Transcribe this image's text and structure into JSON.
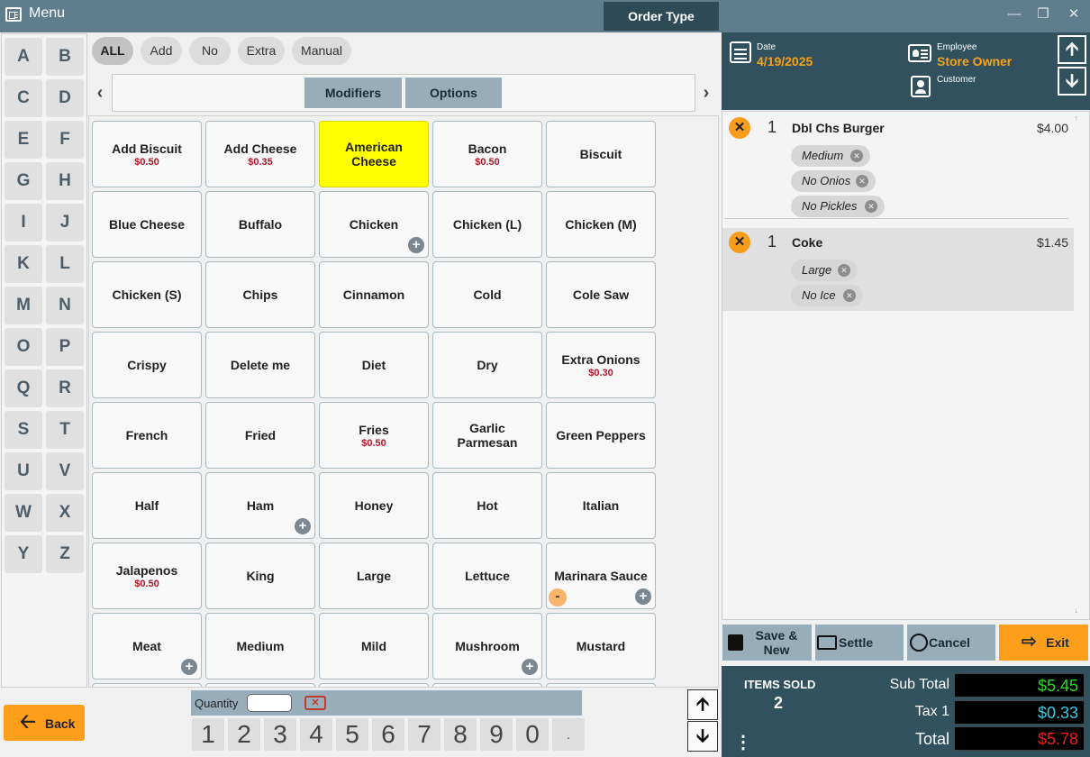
{
  "window": {
    "title": "Menu",
    "order_type": "Order Type"
  },
  "letters": [
    "A",
    "B",
    "C",
    "D",
    "E",
    "F",
    "G",
    "H",
    "I",
    "J",
    "K",
    "L",
    "M",
    "N",
    "O",
    "P",
    "Q",
    "R",
    "S",
    "T",
    "U",
    "V",
    "W",
    "X",
    "Y",
    "Z"
  ],
  "filters": [
    {
      "label": "ALL",
      "active": true
    },
    {
      "label": "Add",
      "active": false
    },
    {
      "label": "No",
      "active": false
    },
    {
      "label": "Extra",
      "active": false
    },
    {
      "label": "Manual",
      "active": false
    }
  ],
  "tabs": [
    {
      "label": "Modifiers"
    },
    {
      "label": "Options"
    }
  ],
  "items": [
    {
      "name": "Add Biscuit",
      "price": "$0.50"
    },
    {
      "name": "Add Cheese",
      "price": "$0.35"
    },
    {
      "name": "American Cheese",
      "selected": true
    },
    {
      "name": "Bacon",
      "price": "$0.50"
    },
    {
      "name": "Biscuit"
    },
    {
      "name": "Blue Cheese"
    },
    {
      "name": "Buffalo"
    },
    {
      "name": "Chicken",
      "plus": true
    },
    {
      "name": "Chicken (L)"
    },
    {
      "name": "Chicken (M)"
    },
    {
      "name": "Chicken (S)"
    },
    {
      "name": "Chips"
    },
    {
      "name": "Cinnamon"
    },
    {
      "name": "Cold"
    },
    {
      "name": "Cole Saw"
    },
    {
      "name": "Crispy"
    },
    {
      "name": "Delete me"
    },
    {
      "name": "Diet"
    },
    {
      "name": "Dry"
    },
    {
      "name": "Extra Onions",
      "price": "$0.30"
    },
    {
      "name": "French"
    },
    {
      "name": "Fried"
    },
    {
      "name": "Fries",
      "price": "$0.50"
    },
    {
      "name": "Garlic Parmesan"
    },
    {
      "name": "Green Peppers"
    },
    {
      "name": "Half"
    },
    {
      "name": "Ham",
      "plus": true
    },
    {
      "name": "Honey"
    },
    {
      "name": "Hot"
    },
    {
      "name": "Italian"
    },
    {
      "name": "Jalapenos",
      "price": "$0.50"
    },
    {
      "name": "King"
    },
    {
      "name": "Large"
    },
    {
      "name": "Lettuce"
    },
    {
      "name": "Marinara Sauce",
      "plus": true,
      "minus": true
    },
    {
      "name": "Meat",
      "plus": true
    },
    {
      "name": "Medium"
    },
    {
      "name": "Mild"
    },
    {
      "name": "Mushroom",
      "plus": true
    },
    {
      "name": "Mustard"
    }
  ],
  "back_label": "Back",
  "quantity": {
    "label": "Quantity",
    "value": ""
  },
  "digits": [
    "1",
    "2",
    "3",
    "4",
    "5",
    "6",
    "7",
    "8",
    "9",
    "0",
    "."
  ],
  "header": {
    "date_label": "Date",
    "date": "4/19/2025",
    "employee_label": "Employee",
    "employee": "Store Owner",
    "customer_label": "Customer"
  },
  "order": [
    {
      "qty": "1",
      "name": "Dbl Chs Burger",
      "price": "$4.00",
      "mods": [
        "Medium",
        "No Onios",
        "No Pickles"
      ]
    },
    {
      "qty": "1",
      "name": "Coke",
      "price": "$1.45",
      "mods": [
        "Large",
        "No Ice"
      ],
      "highlighted": true
    }
  ],
  "actions": {
    "save_new": "Save & New",
    "settle": "Settle",
    "cancel": "Cancel",
    "exit": "Exit"
  },
  "totals": {
    "items_sold_label": "ITEMS SOLD",
    "items_sold": "2",
    "subtotal_label": "Sub Total",
    "subtotal": "$5.45",
    "tax_label": "Tax 1",
    "tax": "$0.33",
    "total_label": "Total",
    "total": "$5.78",
    "subtotal_color": "#22dd22",
    "tax_color": "#3ec8e6",
    "total_color": "#ee1c1c"
  },
  "colors": {
    "accent": "#ff9e1b",
    "header": "#31515e",
    "selected": "#ffff00",
    "price": "#b0182a"
  }
}
